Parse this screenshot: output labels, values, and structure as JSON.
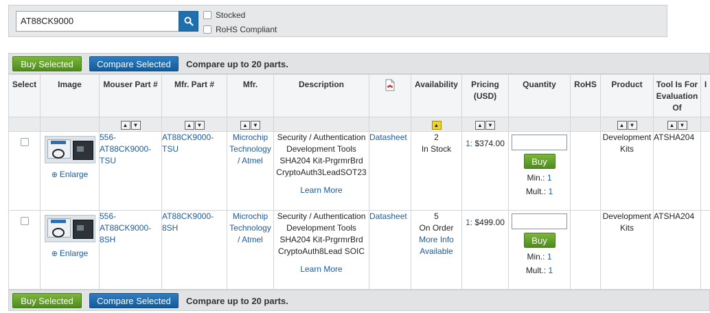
{
  "search": {
    "query": "AT88CK9000",
    "stocked_label": "Stocked",
    "rohs_label": "RoHS Compliant"
  },
  "toolbar": {
    "buy_selected": "Buy Selected",
    "compare_selected": "Compare Selected",
    "compare_note": "Compare up to 20 parts."
  },
  "columns": {
    "select": "Select",
    "image": "Image",
    "mouser_part": "Mouser Part #",
    "mfr_part": "Mfr. Part #",
    "mfr": "Mfr.",
    "description": "Description",
    "availability": "Availability",
    "pricing": "Pricing (USD)",
    "quantity": "Quantity",
    "rohs": "RoHS",
    "product": "Product",
    "tool_for": "Tool Is For Evaluation Of",
    "cutoff": "I"
  },
  "rows": [
    {
      "mouser_part": "556-AT88CK9000-TSU",
      "mfr_part": "AT88CK9000-TSU",
      "mfr": "Microchip Technology / Atmel",
      "description": "Security / Authentication Development Tools SHA204 Kit-PrgrmrBrd CryptoAuth3LeadSOT23",
      "learn_more": "Learn More",
      "datasheet": "Datasheet",
      "avail_qty": "2",
      "avail_status": "In Stock",
      "avail_extra": "",
      "price_break": "1:",
      "price": "$374.00",
      "buy": "Buy",
      "min_label": "Min.:",
      "min_val": "1",
      "mult_label": "Mult.:",
      "mult_val": "1",
      "product": "Development Kits",
      "tool_for": "ATSHA204",
      "enlarge": "Enlarge"
    },
    {
      "mouser_part": "556-AT88CK9000-8SH",
      "mfr_part": "AT88CK9000-8SH",
      "mfr": "Microchip Technology / Atmel",
      "description": "Security / Authentication Development Tools SHA204 Kit-PrgrmrBrd CryptoAuth8Lead SOIC",
      "learn_more": "Learn More",
      "datasheet": "Datasheet",
      "avail_qty": "5",
      "avail_status": "On Order",
      "avail_extra": "More Info Available",
      "price_break": "1:",
      "price": "$499.00",
      "buy": "Buy",
      "min_label": "Min.:",
      "min_val": "1",
      "mult_label": "Mult.:",
      "mult_val": "1",
      "product": "Development Kits",
      "tool_for": "ATSHA204",
      "enlarge": "Enlarge"
    }
  ],
  "colors": {
    "buy_green": "#5a9a26",
    "compare_blue": "#1a66a8",
    "link": "#1c5a9c",
    "sort_active": "#f2d52a"
  },
  "icons": {
    "search": "magnifier",
    "pdf": "pdf-document",
    "enlarge": "zoom-in"
  }
}
